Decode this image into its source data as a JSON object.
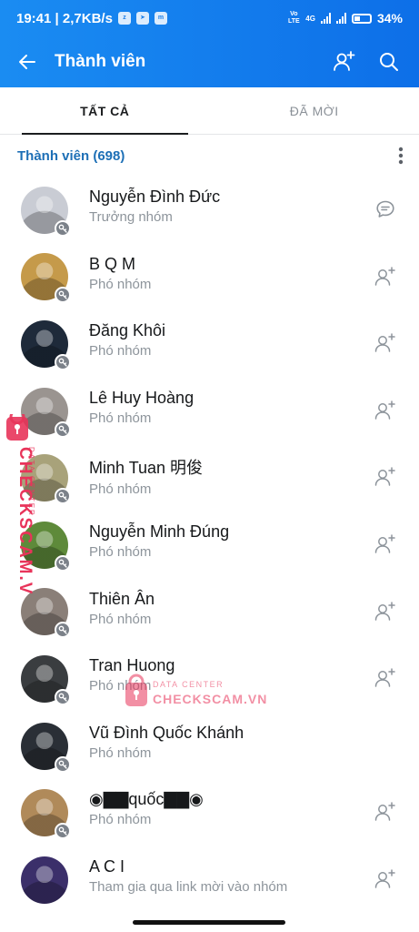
{
  "status_bar": {
    "time_speed": "19:41 | 2,7KB/s",
    "network_label": "4G",
    "volte_label": "Vo LTE",
    "battery": "34%"
  },
  "app_bar": {
    "title": "Thành viên"
  },
  "tabs": [
    {
      "label": "TẤT CẢ",
      "active": true
    },
    {
      "label": "ĐÃ MỜI",
      "active": false
    }
  ],
  "section": {
    "label": "Thành viên (698)"
  },
  "members": [
    {
      "name": "Nguyễn Đình Đức",
      "role": "Trưởng nhóm",
      "action": "chat-icon",
      "key": true,
      "avatar_color": "#c9ccd4"
    },
    {
      "name": "B Q M",
      "role": "Phó nhóm",
      "action": "add-friend-icon",
      "key": true,
      "avatar_color": "#c59a4a"
    },
    {
      "name": "Đăng Khôi",
      "role": "Phó nhóm",
      "action": "add-friend-icon",
      "key": true,
      "avatar_color": "#1e2a3a"
    },
    {
      "name": "Lê Huy Hoàng",
      "role": "Phó nhóm",
      "action": "add-friend-icon",
      "key": true,
      "avatar_color": "#9a9490"
    },
    {
      "name": "Minh Tuan 明俊",
      "role": "Phó nhóm",
      "action": "add-friend-icon",
      "key": true,
      "avatar_color": "#a8a27a"
    },
    {
      "name": "Nguyễn Minh Đúng",
      "role": "Phó nhóm",
      "action": "add-friend-icon",
      "key": true,
      "avatar_color": "#5e8a3a"
    },
    {
      "name": "Thiên Ân",
      "role": "Phó nhóm",
      "action": "add-friend-icon",
      "key": true,
      "avatar_color": "#8a7f78"
    },
    {
      "name": "Tran Huong",
      "role": "Phó nhóm",
      "action": "add-friend-icon",
      "key": true,
      "avatar_color": "#3a3d40"
    },
    {
      "name": "Vũ Đình Quốc Khánh",
      "role": "Phó nhóm",
      "action": "none",
      "key": true,
      "avatar_color": "#2a2f36"
    },
    {
      "name": "◉▇▇quốc▇▇◉",
      "role": "Phó nhóm",
      "action": "add-friend-icon",
      "key": true,
      "avatar_color": "#b08a5a"
    },
    {
      "name": "A C I",
      "role": "Tham gia qua link mời vào nhóm",
      "action": "add-friend-icon",
      "key": false,
      "avatar_color": "#3b2f6a"
    }
  ],
  "watermark": {
    "brand": "CHECKSCAM.VN",
    "sub": "DATA CENTER",
    "color": "#e8345a"
  },
  "colors": {
    "header_blue": "#1a8cf2",
    "section_blue": "#1d6fb6",
    "text_primary": "#16181a",
    "text_secondary": "#8d949b"
  }
}
